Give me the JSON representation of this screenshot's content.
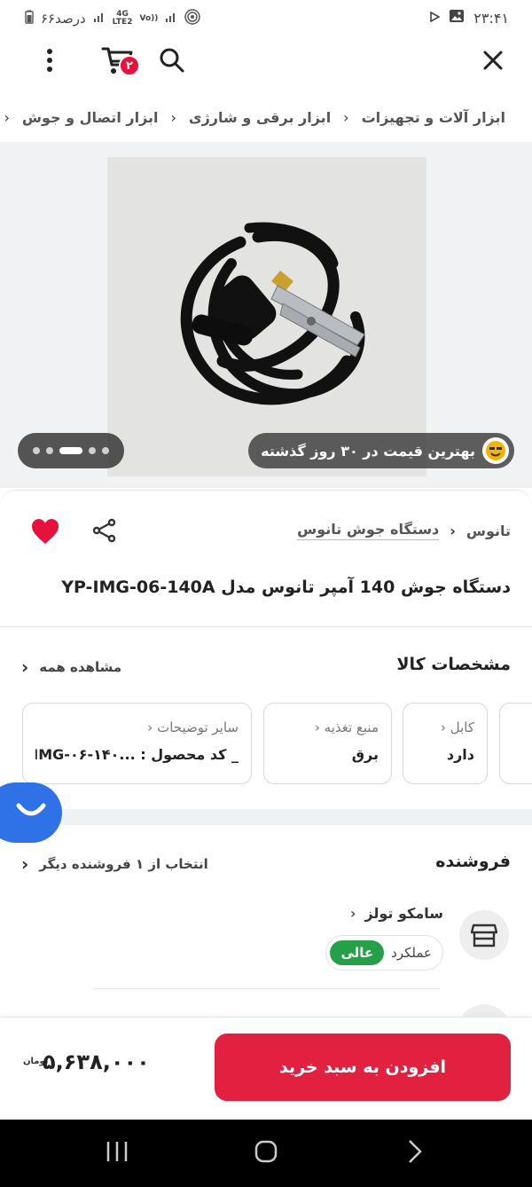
{
  "status_bar": {
    "time": "۲۳:۴۱",
    "battery": "۶۶درصد",
    "network_top": "4G",
    "network_bottom": "LTE2",
    "volte": "Vo))"
  },
  "toolbar": {
    "cart_count": "۲",
    "icons": [
      "close-icon",
      "search-icon",
      "cart-icon",
      "more-vertical-icon"
    ]
  },
  "breadcrumbs": [
    "ابزار آلات و تجهیزات",
    "ابزار برقی و شارژی",
    "ابزار اتصال و جوش",
    "د"
  ],
  "gallery": {
    "best_price_label": "بهترین قیمت در ۳۰ روز گذشته",
    "pages": 5,
    "active_page": 3
  },
  "product": {
    "brand": "تانوس",
    "category": "دستگاه جوش تانوس",
    "title": "دستگاه جوش 140 آمپر تانوس مدل YP-IMG-06-140A",
    "favorite": true
  },
  "specs": {
    "title": "مشخصات کالا",
    "see_all": "مشاهده همه",
    "cards": [
      {
        "key": "کابل",
        "value": "دارد"
      },
      {
        "key": "منبع تغذیه",
        "value": "برق"
      },
      {
        "key": "سایر توضیحات",
        "value": "_ کد محصول : ...IMG-۰۶-۱۴۰"
      }
    ]
  },
  "seller": {
    "title": "فروشنده",
    "choose_label": "انتخاب از ۱ فروشنده دیگر",
    "name": "سامکو تولز",
    "performance_label": "عملکرد",
    "performance_value": "عالی"
  },
  "buy": {
    "button_label": "افزودن به سبد خرید",
    "price": "۵,۶۳۸,۰۰۰",
    "currency": "تومان"
  },
  "colors": {
    "primary": "#e1213f",
    "badge": "#e6123d",
    "chat": "#2f72e8",
    "excellent": "#26a048"
  }
}
